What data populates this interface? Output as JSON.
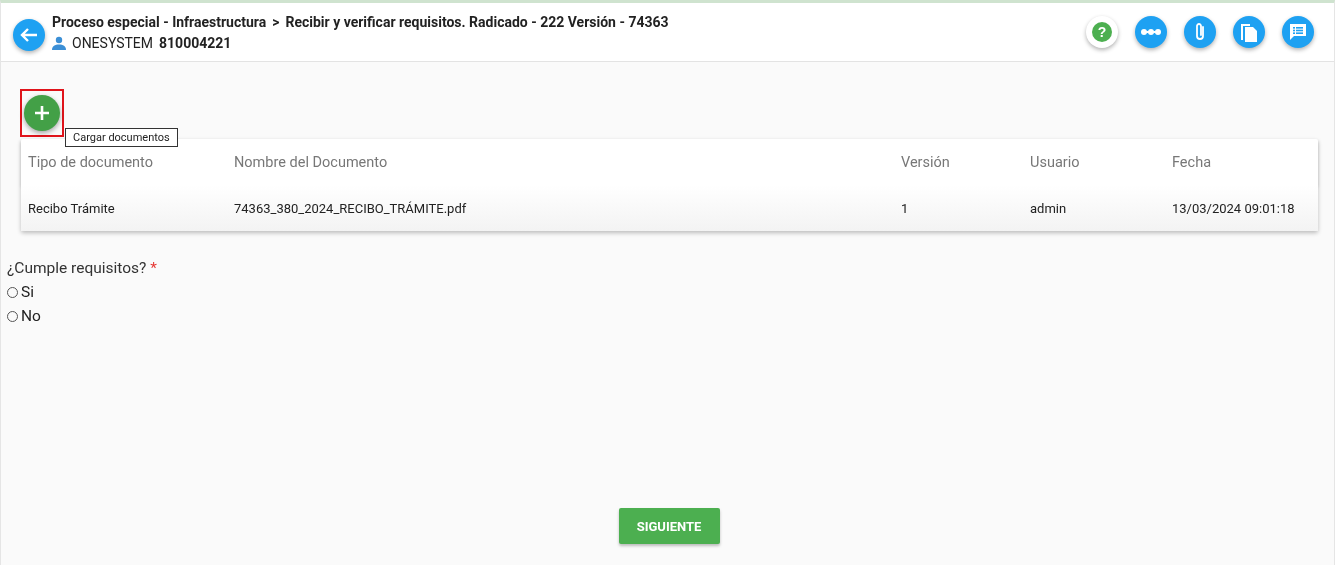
{
  "header": {
    "breadcrumb": [
      "Proceso especial - Infraestructura",
      "Recibir y verificar requisitos. Radicado - 222 Versión - 74363"
    ],
    "separator": ">",
    "user_name": "ONESYSTEM",
    "user_id": "810004221"
  },
  "toolbar": [
    {
      "kind": "help",
      "glyph": "?"
    },
    {
      "kind": "dots"
    },
    {
      "kind": "clip"
    },
    {
      "kind": "copy"
    },
    {
      "kind": "comment"
    }
  ],
  "add_button": {
    "highlighted": true,
    "tooltip": "Cargar documentos"
  },
  "table": {
    "columns": [
      "Tipo de documento",
      "Nombre del Documento",
      "Versión",
      "Usuario",
      "Fecha"
    ],
    "rows": [
      [
        "Recibo Trámite",
        "74363_380_2024_RECIBO_TRÁMITE.pdf",
        "1",
        "admin",
        "13/03/2024 09:01:18"
      ]
    ]
  },
  "question": {
    "label": "¿Cumple requisitos?",
    "required_mark": "*",
    "options": [
      {
        "label": "Si",
        "selected": false
      },
      {
        "label": "No",
        "selected": false
      }
    ]
  },
  "next_button": "SIGUIENTE"
}
